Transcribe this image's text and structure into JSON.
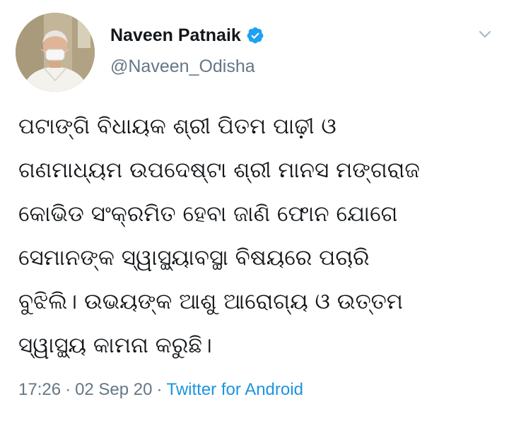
{
  "author": {
    "display_name": "Naveen Patnaik",
    "handle": "@Naveen_Odisha",
    "verified": true
  },
  "tweet": {
    "lines": [
      "ପଟାଙ୍ଗି ବିଧାୟକ ଶ୍ରୀ ପିତମ ପାଢ଼ୀ ଓ",
      "ଗଣମାଧ୍ୟମ ଉପଦେଷ୍ଟା ଶ୍ରୀ ମାନସ ମଙ୍ଗରାଜ",
      "କୋଭିଡ ସଂକ୍ରମିତ ହେବା ଜାଣି ଫୋନ ଯୋଗେ",
      "ସେମାନଙ୍କ ସ୍ୱାସ୍ଥ୍ୟାବସ୍ଥା ବିଷୟରେ ପଚାରି",
      "ବୁଝିଲି। ଉଭୟଙ୍କ ଆଶୁ ଆରୋଗ୍ୟ ଓ ଉତ୍ତମ",
      "ସ୍ୱାସ୍ଥ୍ୟ କାମନା କରୁଛି।"
    ]
  },
  "meta": {
    "time": "17:26",
    "separator": "·",
    "date": "02 Sep 20",
    "source": "Twitter for Android"
  },
  "colors": {
    "text": "#14171a",
    "secondary": "#657786",
    "link": "#1b95e0",
    "verified_badge": "#1da1f2",
    "chevron": "#aab8c2"
  },
  "icons": {
    "verified": "verified-badge-icon",
    "menu": "chevron-down-icon"
  }
}
